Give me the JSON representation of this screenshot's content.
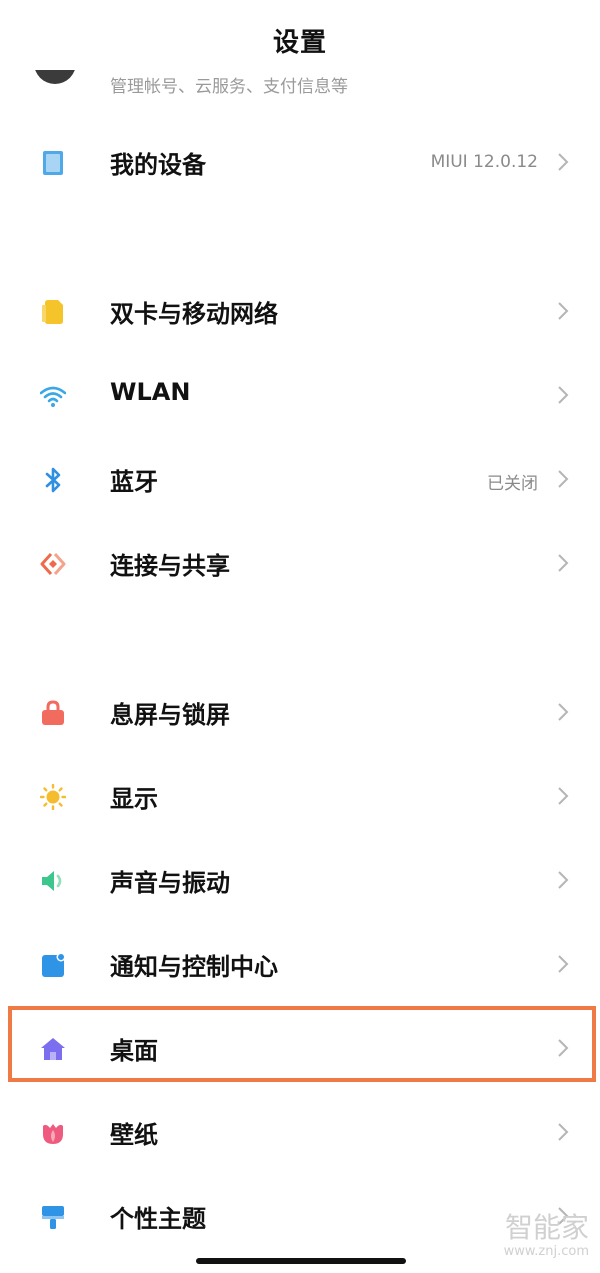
{
  "header": {
    "title": "设置"
  },
  "account": {
    "subtitle": "管理帐号、云服务、支付信息等"
  },
  "items": [
    {
      "key": "device",
      "label": "我的设备",
      "value": "MIUI 12.0.12",
      "icon": "tablet-icon",
      "color": "#4fa8e8"
    },
    {
      "key": "sim",
      "label": "双卡与移动网络",
      "value": "",
      "icon": "sim-card-icon",
      "color": "#f5c42b"
    },
    {
      "key": "wlan",
      "label": "WLAN",
      "value": "",
      "icon": "wifi-icon",
      "color": "#3aa7e6"
    },
    {
      "key": "bluetooth",
      "label": "蓝牙",
      "value": "已关闭",
      "icon": "bluetooth-icon",
      "color": "#2f8fe0"
    },
    {
      "key": "share",
      "label": "连接与共享",
      "value": "",
      "icon": "connection-icon",
      "color": "#ef6a4a"
    },
    {
      "key": "lock",
      "label": "息屏与锁屏",
      "value": "",
      "icon": "lock-icon",
      "color": "#f26b5f"
    },
    {
      "key": "display",
      "label": "显示",
      "value": "",
      "icon": "sun-icon",
      "color": "#f5bd2e"
    },
    {
      "key": "sound",
      "label": "声音与振动",
      "value": "",
      "icon": "speaker-icon",
      "color": "#3ec78d"
    },
    {
      "key": "notify",
      "label": "通知与控制中心",
      "value": "",
      "icon": "notification-icon",
      "color": "#2f93e6"
    },
    {
      "key": "desktop",
      "label": "桌面",
      "value": "",
      "icon": "home-icon",
      "color": "#7b6ff0"
    },
    {
      "key": "wallpaper",
      "label": "壁纸",
      "value": "",
      "icon": "tulip-icon",
      "color": "#ee5b7f"
    },
    {
      "key": "theme",
      "label": "个性主题",
      "value": "",
      "icon": "brush-icon",
      "color": "#2f93e6"
    }
  ],
  "watermark": {
    "main": "智能家",
    "sub": "www.znj.com"
  },
  "highlight_color": "#f07a45"
}
